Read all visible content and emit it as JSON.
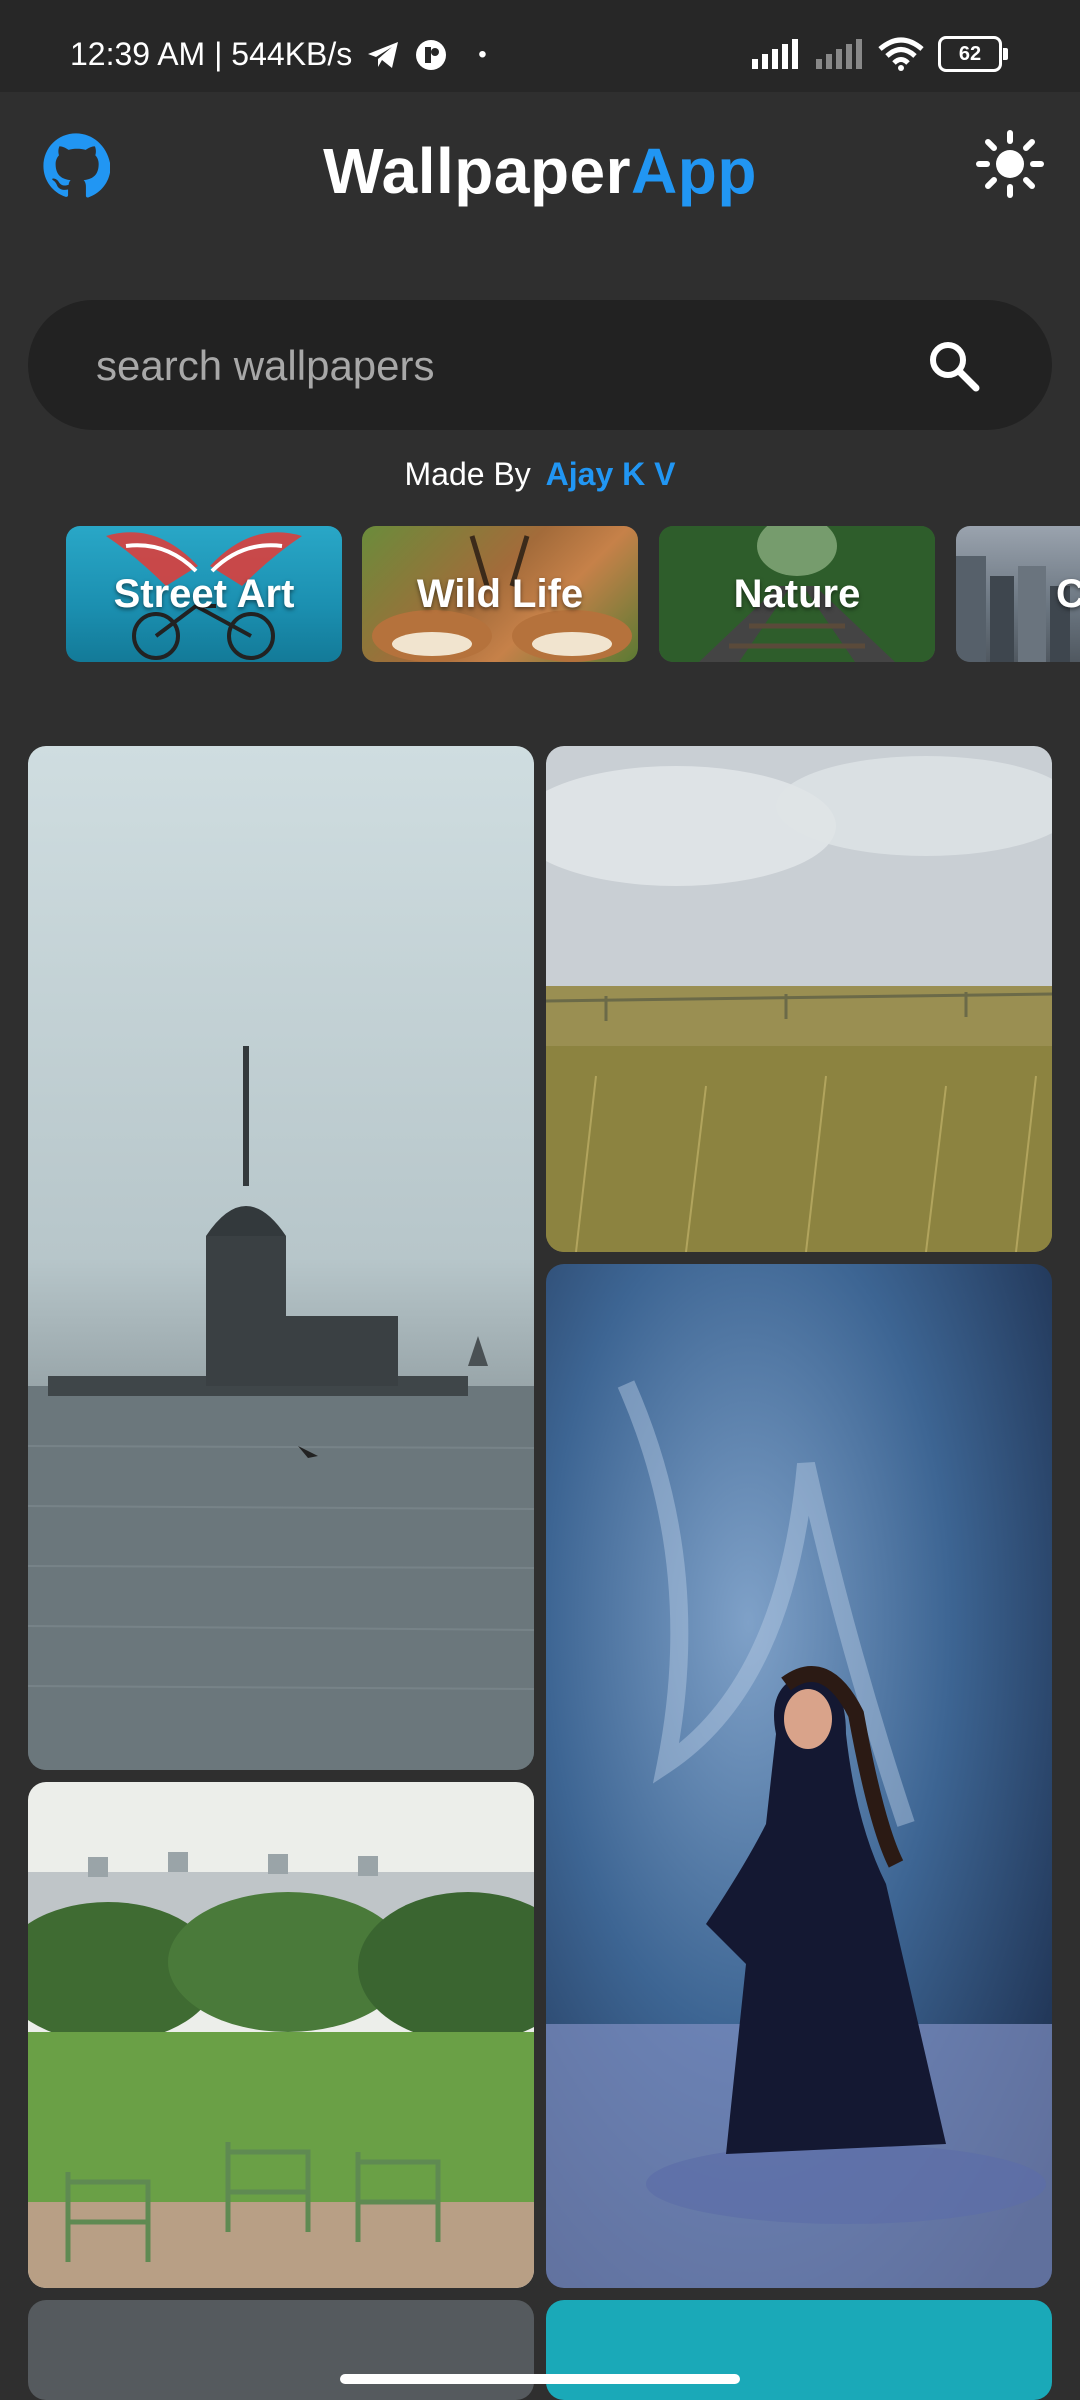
{
  "status_bar": {
    "time_speed": "12:39 AM | 544KB/s",
    "dot": "•",
    "battery": "62"
  },
  "header": {
    "title_main": "Wallpaper",
    "title_accent": "App",
    "accent_color": "#2196f3"
  },
  "search": {
    "placeholder": "search wallpapers"
  },
  "credit": {
    "prefix": "Made By",
    "author": "Ajay K V"
  },
  "categories": [
    {
      "label": "Street Art"
    },
    {
      "label": "Wild Life"
    },
    {
      "label": "Nature"
    },
    {
      "label": "C"
    }
  ],
  "icons": {
    "github": "github-icon",
    "theme": "sun-icon",
    "search": "search-icon"
  }
}
